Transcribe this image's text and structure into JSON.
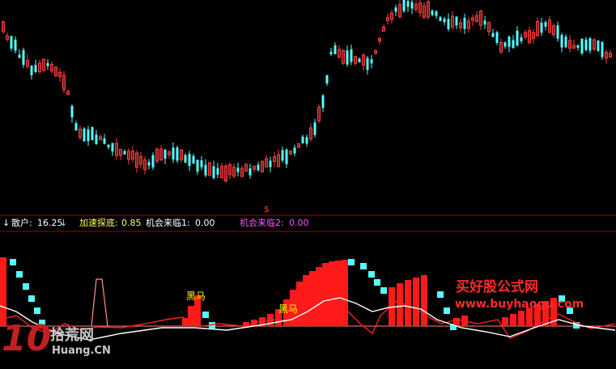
{
  "indicator_bar": {
    "down_arrow": "↓",
    "sanhu_label": "散户:",
    "sanhu_value": "16.25",
    "sanhu_arrow": "↓",
    "accel_label": "加速探底:",
    "accel_value": "0.85",
    "chance1_label": "机会来临1:",
    "chance1_value": "0.00",
    "chance2_label": "机会来临2:",
    "chance2_value": "0.00"
  },
  "price_marker": "$",
  "badges": [
    "黑马",
    "黑马"
  ],
  "watermarks": {
    "site_title": "买好股公式网",
    "site_url": "www.buyhaogu.com",
    "logo_digits": "10",
    "logo_chars": "拾荒网",
    "logo_url": "Huang.CN"
  },
  "colors": {
    "background": "#000000",
    "up_candle": "#ff3c3c",
    "down_candle": "#54ffff",
    "red_line": "#ff2020",
    "white_line": "#ffffff",
    "cyan_bars": "#54ffff",
    "red_bars": "#ff1a1a",
    "separator": "#b00000",
    "label_white": "#ffffff",
    "label_yellow": "#ffff54",
    "label_magenta": "#ff54ff",
    "watermark_red": "#ff2a2a"
  }
}
